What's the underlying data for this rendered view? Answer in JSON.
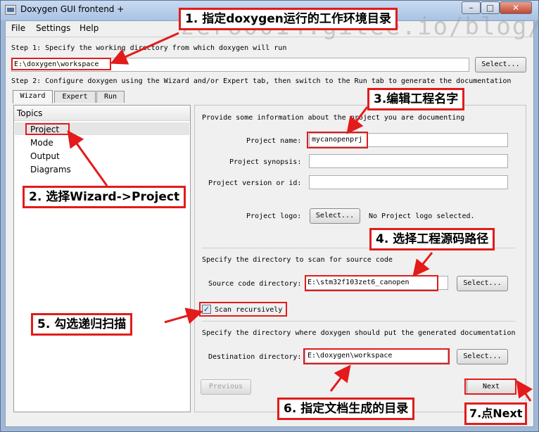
{
  "window": {
    "title": "Doxygen GUI frontend +",
    "minimize": "–",
    "maximize": "□",
    "close": "✕"
  },
  "menu": {
    "file": "File",
    "settings": "Settings",
    "help": "Help"
  },
  "step1": {
    "label": "Step 1: Specify the working directory from which doxygen will run",
    "workdir_value": "E:\\doxygen\\workspace",
    "select_label": "Select..."
  },
  "step2": {
    "label": "Step 2: Configure doxygen using the Wizard and/or Expert tab, then switch to the Run tab to generate the documentation"
  },
  "tabs": [
    "Wizard",
    "Expert",
    "Run"
  ],
  "topics": {
    "header": "Topics",
    "items": [
      "Project",
      "Mode",
      "Output",
      "Diagrams"
    ]
  },
  "project": {
    "intro": "Provide some information about the project you are documenting",
    "name_label": "Project name:",
    "name_value": "mycanopenprj",
    "synopsis_label": "Project synopsis:",
    "synopsis_value": "",
    "version_label": "Project version or id:",
    "version_value": "",
    "logo_label": "Project logo:",
    "logo_button": "Select...",
    "logo_status": "No Project logo selected.",
    "source_intro": "Specify the directory to scan for source code",
    "source_label": "Source code directory:",
    "source_value": "E:\\stm32f103zet6_canopen",
    "source_select": "Select...",
    "scan_recursive_label": "Scan recursively",
    "scan_recursive_checked": true,
    "dest_intro": "Specify the directory where doxygen should put the generated documentation",
    "dest_label": "Destination directory:",
    "dest_value": "E:\\doxygen\\workspace",
    "dest_select": "Select..."
  },
  "nav": {
    "previous": "Previous",
    "next": "Next"
  },
  "annotations": [
    "1. 指定doxygen运行的工作环境目录",
    "2. 选择Wizard->Project",
    "3.编辑工程名字",
    "4. 选择工程源码路径",
    "5. 勾选递归扫描",
    "6. 指定文档生成的目录",
    "7.点Next"
  ],
  "watermark": "zero0014.gitee.io/blog/",
  "colors": {
    "annotation_red": "#e31b1b",
    "title_bar": "#b9cfea",
    "client_bg": "#f0f0f0"
  }
}
